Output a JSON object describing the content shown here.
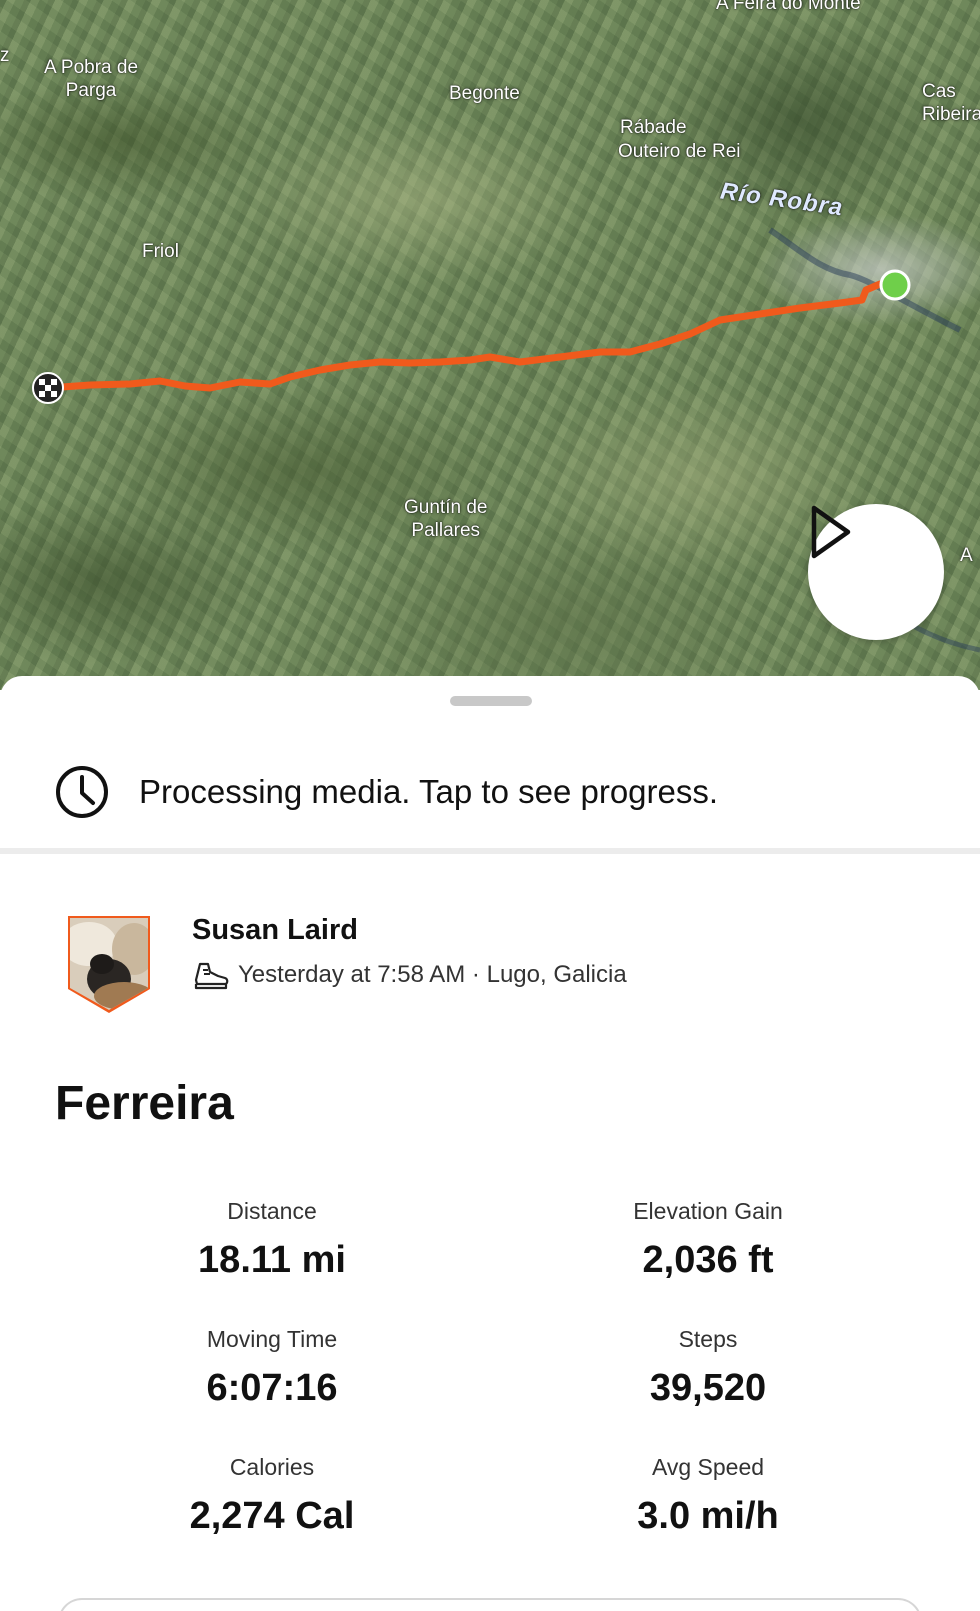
{
  "map": {
    "labels": {
      "a_pobra": "A Pobra de\nParga",
      "begonte": "Begonte",
      "rabade": "Rábade",
      "outeiro": "Outeiro de Rei",
      "rio_robra": "Río Robra",
      "friol": "Friol",
      "guntin": "Guntín de\nPallares",
      "a_feira": "A Feira do Monte",
      "cas_ribeira": "Cas\nRibeira",
      "a_edge": "A",
      "z_edge": "z"
    },
    "route_color": "#f05a1c",
    "start_color": "#6fcf4a",
    "play_icon": "play-icon"
  },
  "processing": {
    "icon": "clock-icon",
    "text": "Processing media. Tap to see progress."
  },
  "athlete": {
    "name": "Susan Laird",
    "activity_icon": "hiking-shoe-icon",
    "meta": "Yesterday at 7:58 AM · Lugo, Galicia"
  },
  "activity": {
    "title": "Ferreira"
  },
  "stats": [
    {
      "label": "Distance",
      "value": "18.11 mi"
    },
    {
      "label": "Elevation Gain",
      "value": "2,036 ft"
    },
    {
      "label": "Moving Time",
      "value": "6:07:16"
    },
    {
      "label": "Steps",
      "value": "39,520"
    },
    {
      "label": "Calories",
      "value": "2,274 Cal"
    },
    {
      "label": "Avg Speed",
      "value": "3.0 mi/h"
    }
  ],
  "colors": {
    "brand_orange": "#f05a1c",
    "text": "#111111"
  }
}
